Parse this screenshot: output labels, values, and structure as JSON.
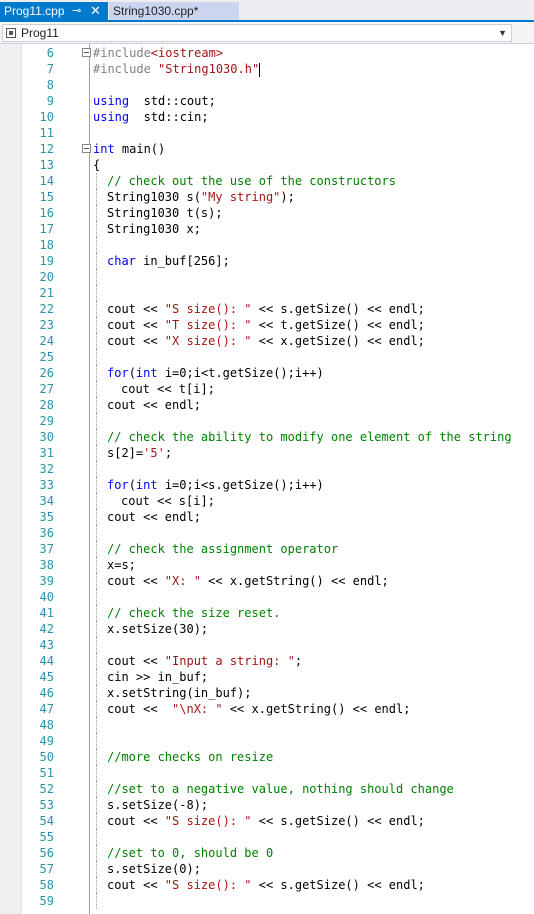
{
  "tabs": [
    {
      "label": "Prog11.cpp",
      "pin": "⊸",
      "close": "✕"
    },
    {
      "label": "String1030.cpp*"
    }
  ],
  "nav": {
    "project": "Prog11"
  },
  "lines": [
    {
      "n": "6",
      "tokens": [
        [
          "pre",
          "#include"
        ],
        [
          "str",
          "<iostream>"
        ]
      ],
      "indent": 0,
      "outline": true
    },
    {
      "n": "7",
      "tokens": [
        [
          "pre",
          "#include "
        ],
        [
          "str",
          "\"String1030.h\""
        ]
      ],
      "indent": 0,
      "caret": true
    },
    {
      "n": "8",
      "tokens": [],
      "indent": 0
    },
    {
      "n": "9",
      "tokens": [
        [
          "kw",
          "using"
        ],
        [
          "",
          "  std::cout;"
        ]
      ],
      "indent": 0
    },
    {
      "n": "10",
      "tokens": [
        [
          "kw",
          "using"
        ],
        [
          "",
          "  std::cin;"
        ]
      ],
      "indent": 0
    },
    {
      "n": "11",
      "tokens": [],
      "indent": 0
    },
    {
      "n": "12",
      "tokens": [
        [
          "kw",
          "int"
        ],
        [
          "",
          " main()"
        ]
      ],
      "indent": 0,
      "outline": true
    },
    {
      "n": "13",
      "tokens": [
        [
          "",
          "{"
        ]
      ],
      "indent": 0
    },
    {
      "n": "14",
      "tokens": [
        [
          "cmt",
          "// check out the use of the constructors"
        ]
      ],
      "indent": 1
    },
    {
      "n": "15",
      "tokens": [
        [
          "",
          "String1030 s("
        ],
        [
          "str",
          "\"My string\""
        ],
        [
          "",
          ");"
        ]
      ],
      "indent": 1
    },
    {
      "n": "16",
      "tokens": [
        [
          "",
          "String1030 t(s);"
        ]
      ],
      "indent": 1
    },
    {
      "n": "17",
      "tokens": [
        [
          "",
          "String1030 x;"
        ]
      ],
      "indent": 1
    },
    {
      "n": "18",
      "tokens": [],
      "indent": 1
    },
    {
      "n": "19",
      "tokens": [
        [
          "kw",
          "char"
        ],
        [
          "",
          " in_buf[256];"
        ]
      ],
      "indent": 1
    },
    {
      "n": "20",
      "tokens": [],
      "indent": 1
    },
    {
      "n": "21",
      "tokens": [],
      "indent": 1
    },
    {
      "n": "22",
      "tokens": [
        [
          "",
          "cout << "
        ],
        [
          "str",
          "\"S size(): \""
        ],
        [
          "",
          " << s.getSize() << endl;"
        ]
      ],
      "indent": 1
    },
    {
      "n": "23",
      "tokens": [
        [
          "",
          "cout << "
        ],
        [
          "str",
          "\"T size(): \""
        ],
        [
          "",
          " << t.getSize() << endl;"
        ]
      ],
      "indent": 1
    },
    {
      "n": "24",
      "tokens": [
        [
          "",
          "cout << "
        ],
        [
          "str",
          "\"X size(): \""
        ],
        [
          "",
          " << x.getSize() << endl;"
        ]
      ],
      "indent": 1
    },
    {
      "n": "25",
      "tokens": [],
      "indent": 1
    },
    {
      "n": "26",
      "tokens": [
        [
          "kw",
          "for"
        ],
        [
          "",
          "("
        ],
        [
          "kw",
          "int"
        ],
        [
          "",
          " i=0;i<t.getSize();i++)"
        ]
      ],
      "indent": 1
    },
    {
      "n": "27",
      "tokens": [
        [
          "",
          "cout << t[i];"
        ]
      ],
      "indent": 2
    },
    {
      "n": "28",
      "tokens": [
        [
          "",
          "cout << endl;"
        ]
      ],
      "indent": 1
    },
    {
      "n": "29",
      "tokens": [],
      "indent": 1
    },
    {
      "n": "30",
      "tokens": [
        [
          "cmt",
          "// check the ability to modify one element of the string"
        ]
      ],
      "indent": 1
    },
    {
      "n": "31",
      "tokens": [
        [
          "",
          "s[2]="
        ],
        [
          "str",
          "'5'"
        ],
        [
          "",
          ";"
        ]
      ],
      "indent": 1
    },
    {
      "n": "32",
      "tokens": [],
      "indent": 1
    },
    {
      "n": "33",
      "tokens": [
        [
          "kw",
          "for"
        ],
        [
          "",
          "("
        ],
        [
          "kw",
          "int"
        ],
        [
          "",
          " i=0;i<s.getSize();i++)"
        ]
      ],
      "indent": 1
    },
    {
      "n": "34",
      "tokens": [
        [
          "",
          "cout << s[i];"
        ]
      ],
      "indent": 2
    },
    {
      "n": "35",
      "tokens": [
        [
          "",
          "cout << endl;"
        ]
      ],
      "indent": 1
    },
    {
      "n": "36",
      "tokens": [],
      "indent": 1
    },
    {
      "n": "37",
      "tokens": [
        [
          "cmt",
          "// check the assignment operator"
        ]
      ],
      "indent": 1
    },
    {
      "n": "38",
      "tokens": [
        [
          "",
          "x=s;"
        ]
      ],
      "indent": 1
    },
    {
      "n": "39",
      "tokens": [
        [
          "",
          "cout << "
        ],
        [
          "str",
          "\"X: \""
        ],
        [
          "",
          " << x.getString() << endl;"
        ]
      ],
      "indent": 1
    },
    {
      "n": "40",
      "tokens": [],
      "indent": 1
    },
    {
      "n": "41",
      "tokens": [
        [
          "cmt",
          "// check the size reset."
        ]
      ],
      "indent": 1
    },
    {
      "n": "42",
      "tokens": [
        [
          "",
          "x.setSize(30);"
        ]
      ],
      "indent": 1
    },
    {
      "n": "43",
      "tokens": [],
      "indent": 1
    },
    {
      "n": "44",
      "tokens": [
        [
          "",
          "cout << "
        ],
        [
          "str",
          "\"Input a string: \""
        ],
        [
          "",
          ";"
        ]
      ],
      "indent": 1
    },
    {
      "n": "45",
      "tokens": [
        [
          "",
          "cin >> in_buf;"
        ]
      ],
      "indent": 1
    },
    {
      "n": "46",
      "tokens": [
        [
          "",
          "x.setString(in_buf);"
        ]
      ],
      "indent": 1
    },
    {
      "n": "47",
      "tokens": [
        [
          "",
          "cout <<  "
        ],
        [
          "str",
          "\"\\nX: \""
        ],
        [
          "",
          " << x.getString() << endl;"
        ]
      ],
      "indent": 1
    },
    {
      "n": "48",
      "tokens": [],
      "indent": 1
    },
    {
      "n": "49",
      "tokens": [],
      "indent": 1
    },
    {
      "n": "50",
      "tokens": [
        [
          "cmt",
          "//more checks on resize"
        ]
      ],
      "indent": 1
    },
    {
      "n": "51",
      "tokens": [],
      "indent": 1
    },
    {
      "n": "52",
      "tokens": [
        [
          "cmt",
          "//set to a negative value, nothing should change"
        ]
      ],
      "indent": 1
    },
    {
      "n": "53",
      "tokens": [
        [
          "",
          "s.setSize(-8);"
        ]
      ],
      "indent": 1
    },
    {
      "n": "54",
      "tokens": [
        [
          "",
          "cout << "
        ],
        [
          "str",
          "\"S size(): \""
        ],
        [
          "",
          " << s.getSize() << endl;"
        ]
      ],
      "indent": 1
    },
    {
      "n": "55",
      "tokens": [],
      "indent": 1
    },
    {
      "n": "56",
      "tokens": [
        [
          "cmt",
          "//set to 0, should be 0"
        ]
      ],
      "indent": 1
    },
    {
      "n": "57",
      "tokens": [
        [
          "",
          "s.setSize(0);"
        ]
      ],
      "indent": 1
    },
    {
      "n": "58",
      "tokens": [
        [
          "",
          "cout << "
        ],
        [
          "str",
          "\"S size(): \""
        ],
        [
          "",
          " << s.getSize() << endl;"
        ]
      ],
      "indent": 1
    },
    {
      "n": "59",
      "tokens": [],
      "indent": 1
    }
  ]
}
